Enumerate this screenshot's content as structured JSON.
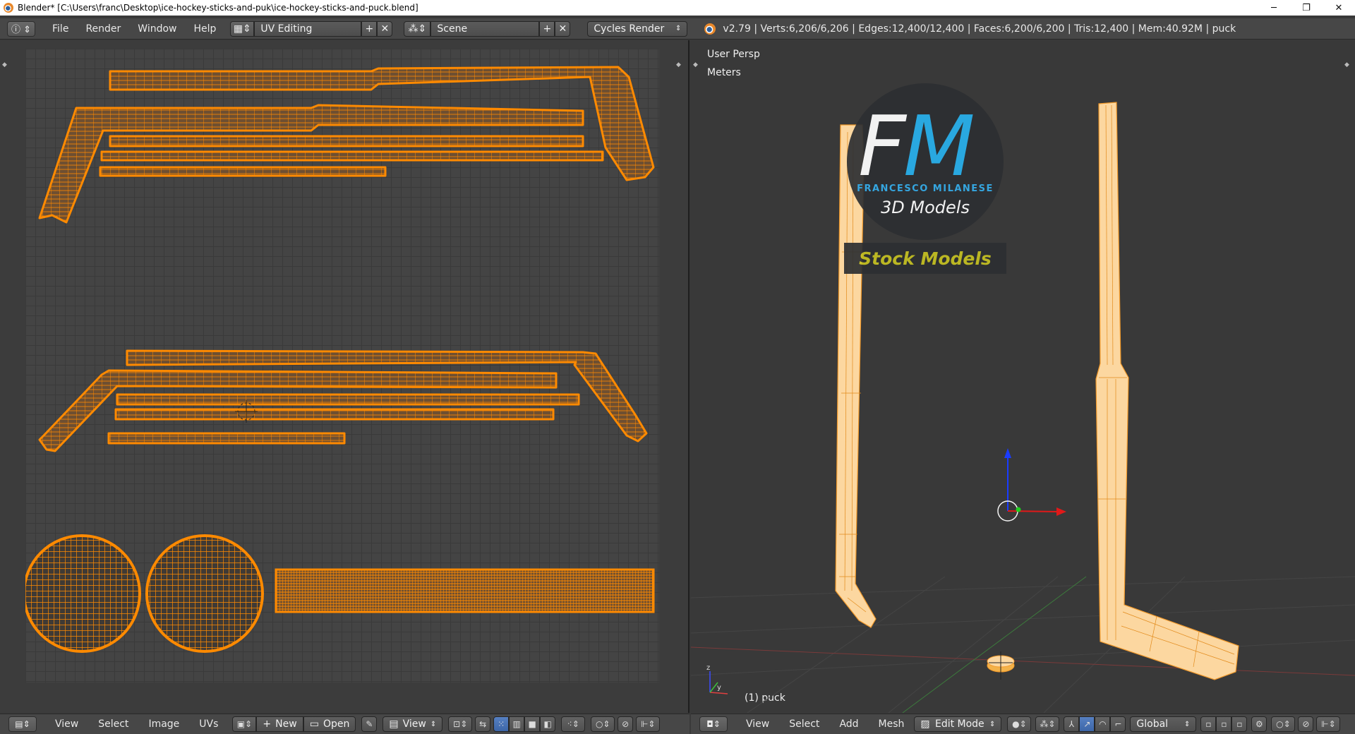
{
  "window": {
    "title": "Blender* [C:\\Users\\franc\\Desktop\\ice-hockey-sticks-and-puk\\ice-hockey-sticks-and-puck.blend]",
    "minimize": "─",
    "restore": "❐",
    "close": "✕"
  },
  "info_header": {
    "menus": [
      "File",
      "Render",
      "Window",
      "Help"
    ],
    "layout": "UV Editing",
    "scene": "Scene",
    "engine": "Cycles Render",
    "stats": "v2.79 | Verts:6,206/6,206 | Edges:12,400/12,400 | Faces:6,200/6,200 | Tris:12,400 | Mem:40.92M | puck"
  },
  "view3d": {
    "view_name": "User Persp",
    "units": "Meters",
    "object_label": "(1) puck"
  },
  "watermark": {
    "letter1": "F",
    "letter2": "M",
    "name": "FRANCESCO MILANESE",
    "subtitle": "3D Models",
    "banner": "Stock Models"
  },
  "uv_header": {
    "menus": [
      "View",
      "Select",
      "Image",
      "UVs"
    ],
    "new_label": "New",
    "open_label": "Open",
    "view_label": "View"
  },
  "view3d_header": {
    "menus": [
      "View",
      "Select",
      "Add",
      "Mesh"
    ],
    "mode": "Edit Mode",
    "orientation": "Global"
  },
  "colors": {
    "uv_edge": "#ff8a00",
    "uv_fill": "#6e4f31",
    "mesh_fill": "#fcd7a0",
    "mesh_edge": "#f39a2a",
    "accent_blue": "#29a8e0",
    "banner_yellow": "#c7c222"
  }
}
